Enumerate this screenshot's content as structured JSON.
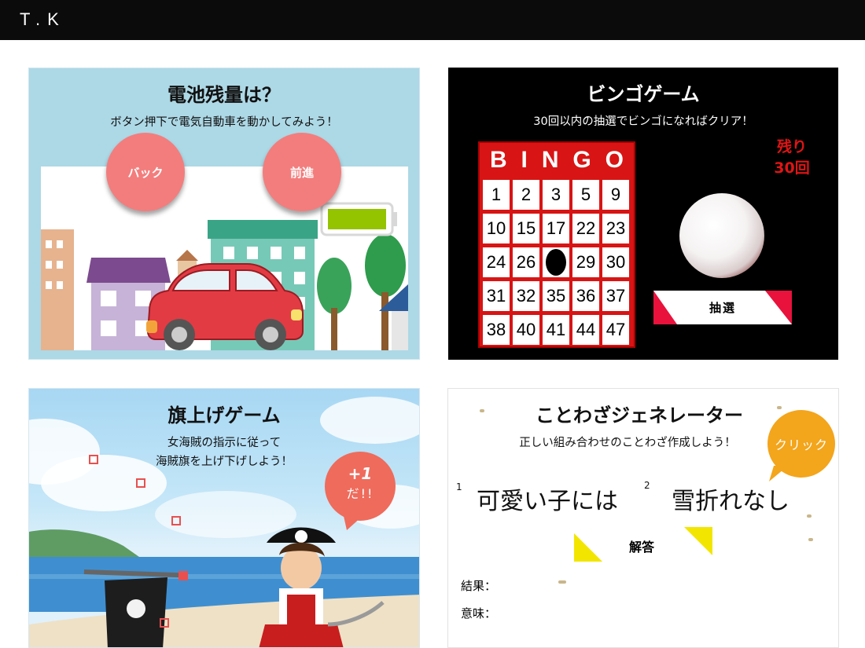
{
  "header": {
    "brand": "T.K"
  },
  "battery_card": {
    "title": "電池残量は？",
    "subtitle": "ボタン押下で電気自動車を動かしてみよう！",
    "back_label": "バック",
    "forward_label": "前進",
    "battery_level": 1.0,
    "colors": {
      "background": "#add8e6",
      "button": "#f37d7d",
      "car": "#e23b44",
      "battery_fill": "#94c300"
    }
  },
  "bingo_card": {
    "title": "ビンゴゲーム",
    "subtitle": "30回以内の抽選でビンゴになればクリア！",
    "header_letters": [
      "B",
      "I",
      "N",
      "G",
      "O"
    ],
    "grid": [
      [
        "1",
        "2",
        "3",
        "5",
        "9"
      ],
      [
        "10",
        "15",
        "17",
        "22",
        "23"
      ],
      [
        "24",
        "26",
        "",
        "29",
        "30"
      ],
      [
        "31",
        "32",
        "35",
        "36",
        "37"
      ],
      [
        "38",
        "40",
        "41",
        "44",
        "47"
      ]
    ],
    "remaining_label": "残り",
    "remaining_count": "30回",
    "draw_label": "抽選",
    "colors": {
      "board": "#d81414",
      "accent": "#e8123c"
    }
  },
  "flag_card": {
    "title": "旗上げゲーム",
    "subtitle_line1": "女海賊の指示に従って",
    "subtitle_line2": "海賊旗を上げ下げしよう！",
    "bubble_line1": "+1",
    "bubble_line2": "だ!!",
    "colors": {
      "bubble": "#ef6b5b",
      "sea": "#3f8fd0"
    }
  },
  "proverb_card": {
    "title": "ことわざジェネレーター",
    "subtitle": "正しい組み合わせのことわざ作成しよう！",
    "click_label": "クリック",
    "part1_number": "1",
    "part1_text": "可愛い子には",
    "part2_number": "2",
    "part2_text": "雪折れなし",
    "answer_label": "解答",
    "result_label": "結果：",
    "meaning_label": "意味：",
    "colors": {
      "click_bubble": "#f3a51c",
      "triangle": "#f2e600"
    }
  }
}
